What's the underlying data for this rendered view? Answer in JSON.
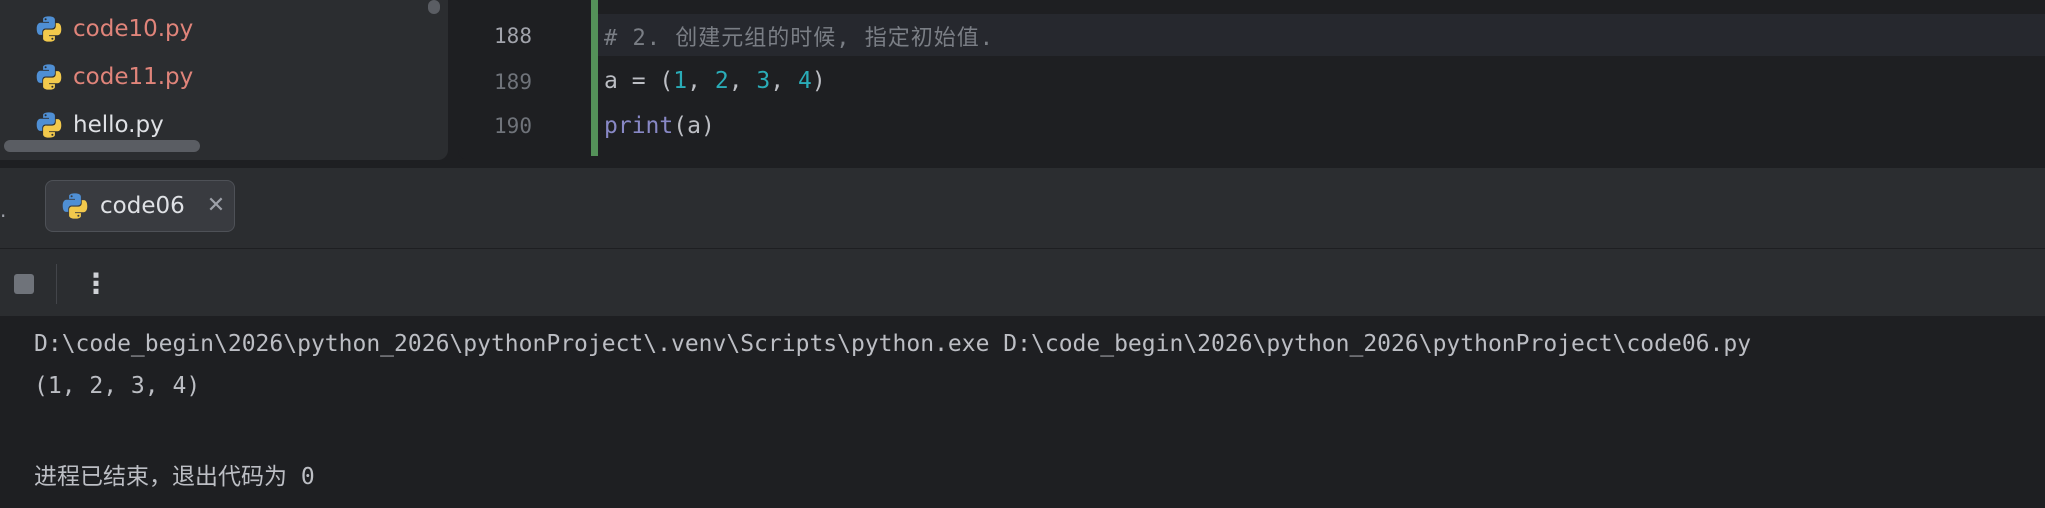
{
  "project_tree": {
    "files": [
      {
        "name": "code10.py",
        "status": "modified"
      },
      {
        "name": "code11.py",
        "status": "modified"
      },
      {
        "name": "hello.py",
        "status": "unchanged"
      }
    ]
  },
  "editor": {
    "lines": [
      {
        "number": "188",
        "text": "# 2. 创建元组的时候, 指定初始值."
      },
      {
        "number": "189",
        "text": "a = (1, 2, 3, 4)"
      },
      {
        "number": "190",
        "text": "print(a)"
      }
    ],
    "tokens": {
      "a": "a",
      "eq": " = ",
      "lparen": "(",
      "one": "1",
      "two": "2",
      "three": "3",
      "four": "4",
      "comma": ", ",
      "rparen": ")",
      "print": "print",
      "print_args": "(a)"
    }
  },
  "run_panel": {
    "tab_label": "code06",
    "close_glyph": "✕",
    "more_glyph": "⋮",
    "console": {
      "command": "D:\\code_begin\\2026\\python_2026\\pythonProject\\.venv\\Scripts\\python.exe D:\\code_begin\\2026\\python_2026\\pythonProject\\code06.py",
      "output": "(1, 2, 3, 4)",
      "exit_message": "进程已结束，退出代码为 0"
    }
  },
  "colors": {
    "background": "#1e1f22",
    "panel": "#2b2d30",
    "modified_file": "#e0847a",
    "number": "#2aacb8",
    "builtin": "#8888c6",
    "comment": "#7a7e85",
    "change_marker": "#549159"
  },
  "icons": {
    "file": "python-file-icon",
    "stop": "stop-icon",
    "more": "more-vertical-icon",
    "close": "close-icon"
  }
}
